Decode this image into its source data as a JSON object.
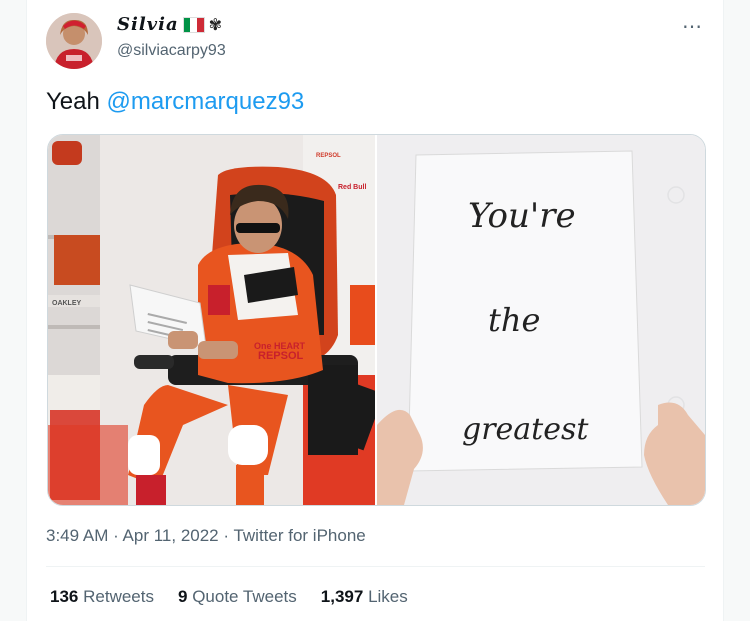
{
  "user": {
    "display_name": "Silvia",
    "handle": "@silviacarpy93",
    "avatar_icon": "user-avatar",
    "bug_glyph": "✾"
  },
  "more_icon": "⋯",
  "tweet": {
    "text": "Yeah ",
    "mention": "@marcmarquez93"
  },
  "media": {
    "sign_line1": "You're",
    "sign_line2": "the",
    "sign_line3": "greatest",
    "sponsor_1": "REPSOL",
    "sponsor_2": "Red Bull",
    "sponsor_3": "OAKLEY",
    "sponsor_4": "One HEART",
    "sponsor_5": "REPSOL"
  },
  "meta": {
    "time": "3:49 AM",
    "sep1": " · ",
    "date": "Apr 11, 2022",
    "sep2": " · ",
    "source": "Twitter for iPhone"
  },
  "stats": {
    "retweets_count": "136",
    "retweets_label": "Retweets",
    "quotes_count": "9",
    "quotes_label": "Quote Tweets",
    "likes_count": "1,397",
    "likes_label": "Likes"
  },
  "colors": {
    "accent": "#1d9bf0",
    "secondary_text": "#536471",
    "flag_green": "#009246",
    "flag_white": "#ffffff",
    "flag_red": "#ce2b37"
  }
}
